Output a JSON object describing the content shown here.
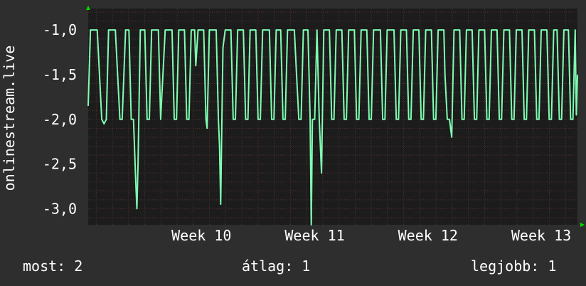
{
  "chart_data": {
    "type": "line",
    "ylabel": "onlinestream.live",
    "ylim": [
      -3.18,
      -0.76
    ],
    "yticks": [
      -1.0,
      -1.5,
      -2.0,
      -2.5,
      -3.0
    ],
    "ytick_labels": [
      "-1,0",
      "-1,5",
      "-2,0",
      "-2,5",
      "-3,0"
    ],
    "xticks": [
      {
        "label": "Week 10",
        "x": 10.5
      },
      {
        "label": "Week 11",
        "x": 11.5
      },
      {
        "label": "Week 12",
        "x": 12.5
      },
      {
        "label": "Week 13",
        "x": 13.5
      }
    ],
    "xlim": [
      9.5,
      13.82
    ],
    "grid": true,
    "series": [
      {
        "color": "#7fffb2",
        "points": [
          [
            9.5,
            -1.85
          ],
          [
            9.52,
            -1.0
          ],
          [
            9.58,
            -1.0
          ],
          [
            9.6,
            -1.5
          ],
          [
            9.62,
            -2.0
          ],
          [
            9.64,
            -2.05
          ],
          [
            9.66,
            -2.0
          ],
          [
            9.68,
            -1.0
          ],
          [
            9.74,
            -1.0
          ],
          [
            9.76,
            -1.5
          ],
          [
            9.78,
            -2.0
          ],
          [
            9.8,
            -2.0
          ],
          [
            9.83,
            -1.0
          ],
          [
            9.86,
            -1.0
          ],
          [
            9.88,
            -2.0
          ],
          [
            9.9,
            -2.0
          ],
          [
            9.92,
            -2.7
          ],
          [
            9.93,
            -3.0
          ],
          [
            9.94,
            -2.5
          ],
          [
            9.96,
            -1.0
          ],
          [
            10.0,
            -1.0
          ],
          [
            10.02,
            -2.0
          ],
          [
            10.04,
            -2.0
          ],
          [
            10.06,
            -1.0
          ],
          [
            10.12,
            -1.0
          ],
          [
            10.14,
            -2.0
          ],
          [
            10.16,
            -1.5
          ],
          [
            10.18,
            -1.0
          ],
          [
            10.24,
            -1.0
          ],
          [
            10.26,
            -2.0
          ],
          [
            10.28,
            -2.0
          ],
          [
            10.3,
            -1.0
          ],
          [
            10.35,
            -1.0
          ],
          [
            10.37,
            -2.0
          ],
          [
            10.39,
            -2.0
          ],
          [
            10.41,
            -1.0
          ],
          [
            10.44,
            -1.0
          ],
          [
            10.45,
            -1.4
          ],
          [
            10.47,
            -1.0
          ],
          [
            10.52,
            -1.0
          ],
          [
            10.54,
            -2.0
          ],
          [
            10.55,
            -2.1
          ],
          [
            10.57,
            -1.0
          ],
          [
            10.63,
            -1.0
          ],
          [
            10.65,
            -2.0
          ],
          [
            10.66,
            -2.3
          ],
          [
            10.67,
            -2.95
          ],
          [
            10.69,
            -1.2
          ],
          [
            10.71,
            -1.0
          ],
          [
            10.76,
            -1.0
          ],
          [
            10.78,
            -2.0
          ],
          [
            10.8,
            -2.0
          ],
          [
            10.82,
            -1.0
          ],
          [
            10.87,
            -1.0
          ],
          [
            10.89,
            -2.0
          ],
          [
            10.91,
            -2.0
          ],
          [
            10.93,
            -1.0
          ],
          [
            10.98,
            -1.0
          ],
          [
            11.0,
            -2.0
          ],
          [
            11.02,
            -2.0
          ],
          [
            11.04,
            -1.0
          ],
          [
            11.1,
            -1.0
          ],
          [
            11.12,
            -2.0
          ],
          [
            11.14,
            -2.0
          ],
          [
            11.16,
            -1.0
          ],
          [
            11.2,
            -1.0
          ],
          [
            11.22,
            -2.0
          ],
          [
            11.24,
            -2.0
          ],
          [
            11.26,
            -1.0
          ],
          [
            11.32,
            -1.0
          ],
          [
            11.34,
            -1.5
          ],
          [
            11.36,
            -2.0
          ],
          [
            11.38,
            -2.0
          ],
          [
            11.4,
            -1.0
          ],
          [
            11.44,
            -1.0
          ],
          [
            11.46,
            -2.0
          ],
          [
            11.47,
            -3.18
          ],
          [
            11.48,
            -2.0
          ],
          [
            11.5,
            -2.0
          ],
          [
            11.52,
            -1.0
          ],
          [
            11.54,
            -2.0
          ],
          [
            11.56,
            -2.6
          ],
          [
            11.58,
            -1.0
          ],
          [
            11.63,
            -1.0
          ],
          [
            11.65,
            -2.0
          ],
          [
            11.67,
            -2.0
          ],
          [
            11.69,
            -1.0
          ],
          [
            11.74,
            -1.0
          ],
          [
            11.76,
            -2.0
          ],
          [
            11.78,
            -2.0
          ],
          [
            11.8,
            -1.0
          ],
          [
            11.85,
            -1.0
          ],
          [
            11.87,
            -2.0
          ],
          [
            11.89,
            -2.0
          ],
          [
            11.91,
            -1.0
          ],
          [
            11.96,
            -1.0
          ],
          [
            11.98,
            -2.0
          ],
          [
            12.0,
            -2.0
          ],
          [
            12.02,
            -1.0
          ],
          [
            12.08,
            -1.0
          ],
          [
            12.1,
            -2.0
          ],
          [
            12.12,
            -2.0
          ],
          [
            12.14,
            -1.0
          ],
          [
            12.2,
            -1.0
          ],
          [
            12.22,
            -2.0
          ],
          [
            12.24,
            -2.0
          ],
          [
            12.26,
            -1.0
          ],
          [
            12.31,
            -1.0
          ],
          [
            12.33,
            -2.0
          ],
          [
            12.35,
            -2.0
          ],
          [
            12.37,
            -1.0
          ],
          [
            12.42,
            -1.0
          ],
          [
            12.44,
            -2.0
          ],
          [
            12.46,
            -2.0
          ],
          [
            12.48,
            -1.0
          ],
          [
            12.53,
            -1.0
          ],
          [
            12.55,
            -2.0
          ],
          [
            12.57,
            -2.0
          ],
          [
            12.59,
            -1.0
          ],
          [
            12.64,
            -1.0
          ],
          [
            12.65,
            -1.5
          ],
          [
            12.67,
            -2.0
          ],
          [
            12.69,
            -2.0
          ],
          [
            12.71,
            -2.2
          ],
          [
            12.73,
            -1.0
          ],
          [
            12.78,
            -1.0
          ],
          [
            12.8,
            -2.0
          ],
          [
            12.82,
            -2.0
          ],
          [
            12.84,
            -1.0
          ],
          [
            12.89,
            -1.0
          ],
          [
            12.91,
            -2.0
          ],
          [
            12.93,
            -2.0
          ],
          [
            12.95,
            -1.0
          ],
          [
            13.0,
            -1.0
          ],
          [
            13.02,
            -2.0
          ],
          [
            13.04,
            -2.0
          ],
          [
            13.06,
            -1.0
          ],
          [
            13.11,
            -1.0
          ],
          [
            13.13,
            -2.0
          ],
          [
            13.15,
            -2.0
          ],
          [
            13.17,
            -1.0
          ],
          [
            13.22,
            -1.0
          ],
          [
            13.24,
            -2.0
          ],
          [
            13.26,
            -2.0
          ],
          [
            13.28,
            -1.0
          ],
          [
            13.33,
            -1.0
          ],
          [
            13.35,
            -2.0
          ],
          [
            13.37,
            -2.0
          ],
          [
            13.39,
            -1.0
          ],
          [
            13.44,
            -1.0
          ],
          [
            13.46,
            -2.0
          ],
          [
            13.48,
            -2.0
          ],
          [
            13.5,
            -1.0
          ],
          [
            13.55,
            -1.0
          ],
          [
            13.57,
            -2.0
          ],
          [
            13.59,
            -2.0
          ],
          [
            13.61,
            -1.0
          ],
          [
            13.64,
            -1.0
          ],
          [
            13.66,
            -2.0
          ],
          [
            13.68,
            -2.0
          ],
          [
            13.7,
            -1.0
          ],
          [
            13.74,
            -1.0
          ],
          [
            13.76,
            -2.0
          ],
          [
            13.78,
            -2.0
          ],
          [
            13.8,
            -1.0
          ],
          [
            13.81,
            -1.95
          ],
          [
            13.82,
            -1.5
          ]
        ]
      }
    ]
  },
  "stats": {
    "now": "most: 2",
    "avg": "átlag: 1",
    "best": "legjobb: 1"
  },
  "colors": {
    "background": "#2e2e2e",
    "plot_background": "#1c1c1c",
    "grid": "#5a2f2f",
    "line": "#7fffb2",
    "arrow": "#00dd00",
    "text": "#ffffff"
  }
}
